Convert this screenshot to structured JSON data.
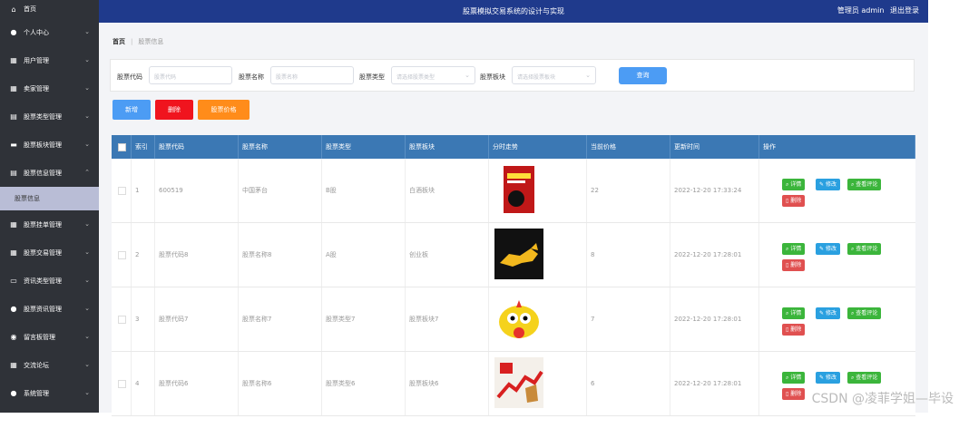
{
  "header": {
    "title": "股票模拟交易系统的设计与实现",
    "user_label": "管理员 admin",
    "logout_label": "退出登录"
  },
  "sidebar": {
    "home": "首页",
    "items": [
      {
        "label": "个人中心",
        "icon": "person-icon"
      },
      {
        "label": "用户管理",
        "icon": "grid-icon"
      },
      {
        "label": "卖家管理",
        "icon": "grid-icon"
      },
      {
        "label": "股票类型管理",
        "icon": "doc-icon"
      },
      {
        "label": "股票板块管理",
        "icon": "briefcase-icon"
      },
      {
        "label": "股票信息管理",
        "icon": "doc-icon"
      },
      {
        "label": "股票挂单管理",
        "icon": "grid-icon"
      },
      {
        "label": "股票交易管理",
        "icon": "grid-icon"
      },
      {
        "label": "资讯类型管理",
        "icon": "monitor-icon"
      },
      {
        "label": "股票资讯管理",
        "icon": "person-icon"
      },
      {
        "label": "留言板管理",
        "icon": "pin-icon"
      },
      {
        "label": "交流论坛",
        "icon": "table-icon"
      },
      {
        "label": "系统管理",
        "icon": "person-icon"
      }
    ],
    "active_sub": "股票信息"
  },
  "breadcrumb": {
    "home": "首页",
    "current": "股票信息"
  },
  "search": {
    "code_label": "股票代码",
    "code_placeholder": "股票代码",
    "name_label": "股票名称",
    "name_placeholder": "股票名称",
    "type_label": "股票类型",
    "type_placeholder": "请选择股票类型",
    "board_label": "股票板块",
    "board_placeholder": "请选择股票板块",
    "query_label": "查询"
  },
  "actions": {
    "add": "新增",
    "delete": "删除",
    "price": "股票价格"
  },
  "table": {
    "headers": [
      "索引",
      "股票代码",
      "股票名称",
      "股票类型",
      "股票板块",
      "分时走势",
      "当前价格",
      "更新时间",
      "操作"
    ],
    "rows": [
      {
        "index": "1",
        "code": "600519",
        "name": "中国茅台",
        "type": "B股",
        "board": "白酒板块",
        "price": "22",
        "time": "2022-12-20 17:33:24"
      },
      {
        "index": "2",
        "code": "股票代码8",
        "name": "股票名称8",
        "type": "A股",
        "board": "创业板",
        "price": "8",
        "time": "2022-12-20 17:28:01"
      },
      {
        "index": "3",
        "code": "股票代码7",
        "name": "股票名称7",
        "type": "股票类型7",
        "board": "股票板块7",
        "price": "7",
        "time": "2022-12-20 17:28:01"
      },
      {
        "index": "4",
        "code": "股票代码6",
        "name": "股票名称6",
        "type": "股票类型6",
        "board": "股票板块6",
        "price": "6",
        "time": "2022-12-20 17:28:01"
      }
    ],
    "op_labels": {
      "detail": "详情",
      "edit": "修改",
      "review": "查看评论",
      "delete": "删除"
    }
  },
  "colors": {
    "header": "#1f3a8c",
    "sidebar": "#2f3238",
    "thead": "#3b78b4",
    "add": "#4c9cf4",
    "delete": "#f0141e",
    "price": "#ff8c1a"
  },
  "watermark": "CSDN @凌菲学姐—毕设"
}
